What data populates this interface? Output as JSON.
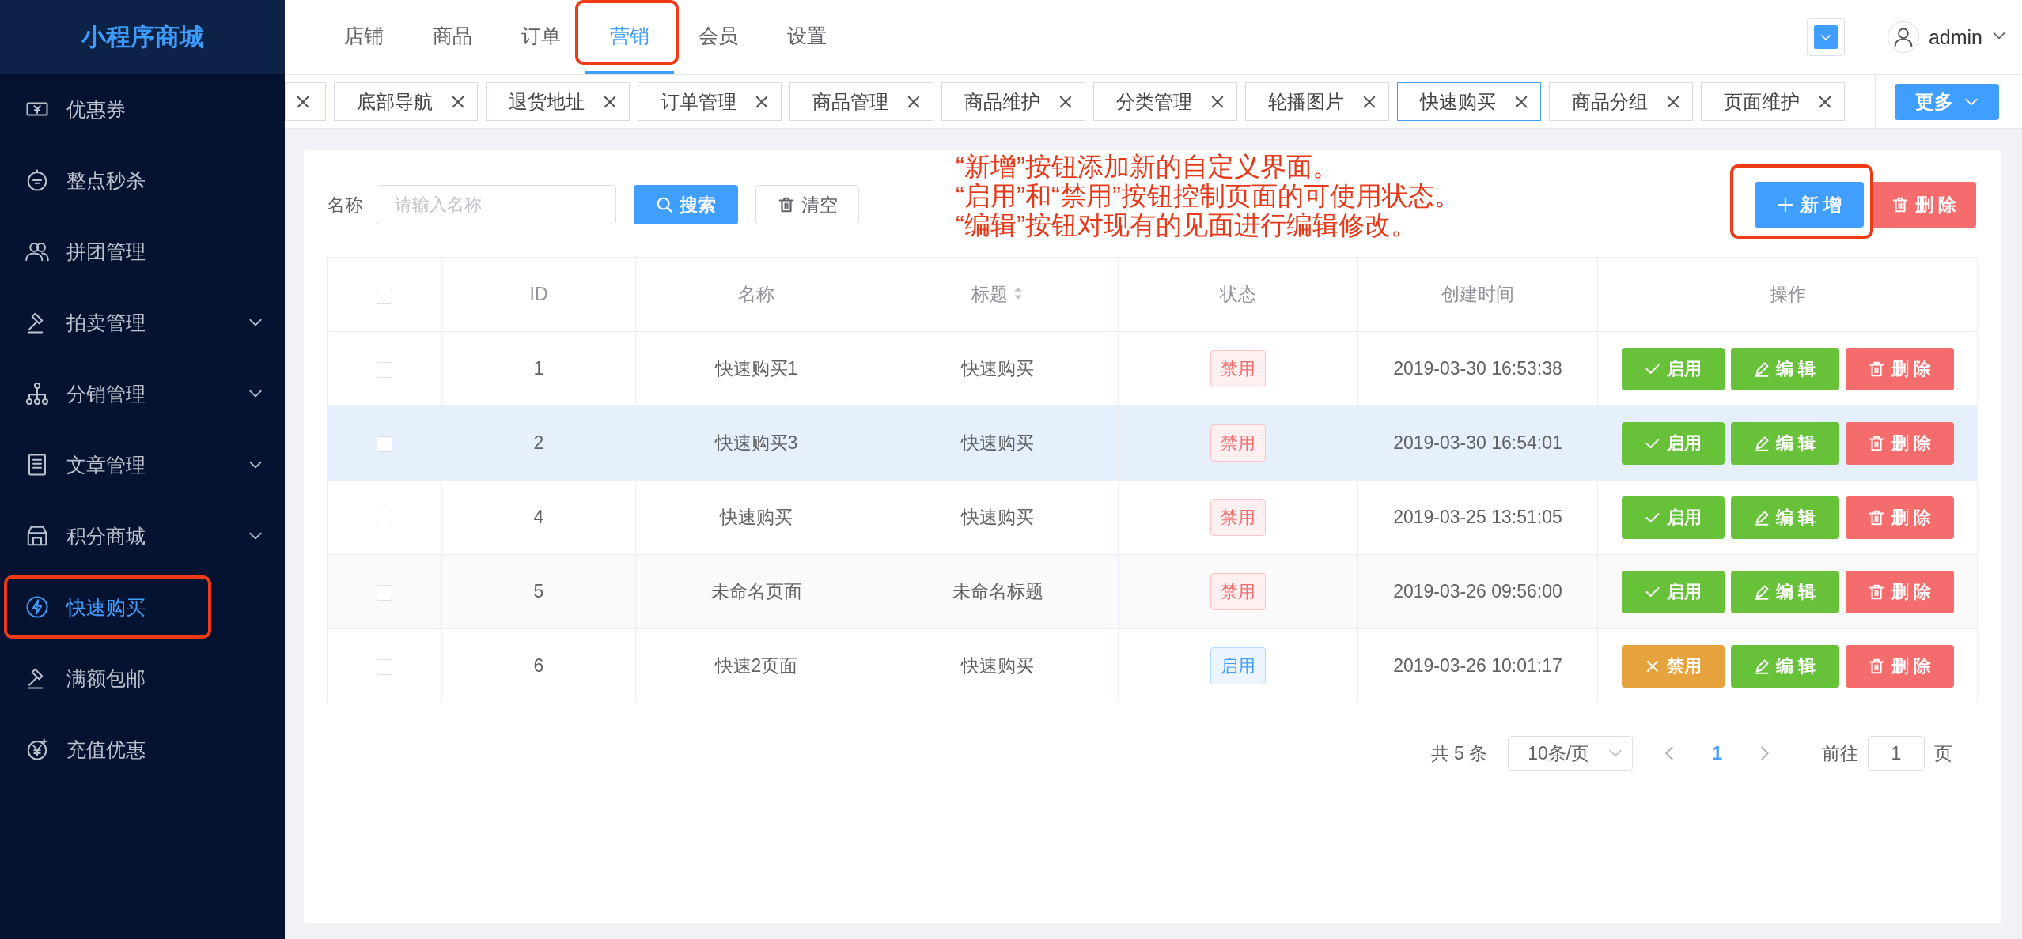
{
  "sidebar": {
    "logo": "小程序商城",
    "items": [
      {
        "label": "优惠券",
        "submenu": false,
        "selected": false,
        "highlighted": false
      },
      {
        "label": "整点秒杀",
        "submenu": false,
        "selected": false,
        "highlighted": false
      },
      {
        "label": "拼团管理",
        "submenu": false,
        "selected": false,
        "highlighted": false
      },
      {
        "label": "拍卖管理",
        "submenu": true,
        "selected": false,
        "highlighted": false
      },
      {
        "label": "分销管理",
        "submenu": true,
        "selected": false,
        "highlighted": false
      },
      {
        "label": "文章管理",
        "submenu": true,
        "selected": false,
        "highlighted": false
      },
      {
        "label": "积分商城",
        "submenu": true,
        "selected": false,
        "highlighted": false
      },
      {
        "label": "快速购买",
        "submenu": false,
        "selected": true,
        "highlighted": true
      },
      {
        "label": "满额包邮",
        "submenu": false,
        "selected": false,
        "highlighted": false
      },
      {
        "label": "充值优惠",
        "submenu": false,
        "selected": false,
        "highlighted": false
      }
    ]
  },
  "top_nav": {
    "items": [
      {
        "label": "店铺",
        "selected": false,
        "highlighted": false
      },
      {
        "label": "商品",
        "selected": false,
        "highlighted": false
      },
      {
        "label": "订单",
        "selected": false,
        "highlighted": false
      },
      {
        "label": "营销",
        "selected": true,
        "highlighted": true
      },
      {
        "label": "会员",
        "selected": false,
        "highlighted": false
      },
      {
        "label": "设置",
        "selected": false,
        "highlighted": false
      }
    ],
    "user": "admin"
  },
  "tags": {
    "items": [
      {
        "selected": false
      },
      {
        "label": "底部导航",
        "selected": false
      },
      {
        "label": "退货地址",
        "selected": false
      },
      {
        "label": "订单管理",
        "selected": false
      },
      {
        "label": "商品管理",
        "selected": false
      },
      {
        "label": "商品维护",
        "selected": false
      },
      {
        "label": "分类管理",
        "selected": false
      },
      {
        "label": "轮播图片",
        "selected": false
      },
      {
        "label": "快速购买",
        "selected": true
      },
      {
        "label": "商品分组",
        "selected": false
      },
      {
        "label": "页面维护",
        "selected": false
      }
    ],
    "more_button": "更多"
  },
  "toolbar": {
    "filter": {
      "label": "名称",
      "placeholder": "请输入名称"
    },
    "search_button": "搜索",
    "clear_button": "清空",
    "add_button": {
      "label": "新 增",
      "highlighted": true
    },
    "delete_button": "删 除"
  },
  "annotation": {
    "lines": [
      "“新增”按钮添加新的自定义界面。",
      "“启用”和“禁用”按钮控制页面的可使用状态。",
      "“编辑”按钮对现有的见面进行编辑修改。"
    ]
  },
  "table": {
    "header_checked": false,
    "columns": [
      {
        "label": "ID",
        "sortable": false
      },
      {
        "label": "名称",
        "sortable": false
      },
      {
        "label": "标题",
        "sortable": true
      },
      {
        "label": "状态",
        "sortable": false
      },
      {
        "label": "创建时间",
        "sortable": false
      },
      {
        "label": "操作",
        "sortable": false
      }
    ],
    "rows": [
      {
        "checked": false,
        "hovered": false,
        "id": "1",
        "name": "快速购买1",
        "title": "快速购买",
        "status": {
          "label": "禁用",
          "kind": "disabled"
        },
        "created": "2019-03-30 16:53:38",
        "actions": [
          {
            "label": "启用",
            "kind": "enable"
          },
          {
            "label": "编 辑",
            "kind": "edit"
          },
          {
            "label": "删 除",
            "kind": "delete"
          }
        ]
      },
      {
        "checked": false,
        "hovered": true,
        "id": "2",
        "name": "快速购买3",
        "title": "快速购买",
        "status": {
          "label": "禁用",
          "kind": "disabled"
        },
        "created": "2019-03-30 16:54:01",
        "actions": [
          {
            "label": "启用",
            "kind": "enable"
          },
          {
            "label": "编 辑",
            "kind": "edit"
          },
          {
            "label": "删 除",
            "kind": "delete"
          }
        ]
      },
      {
        "checked": false,
        "hovered": false,
        "id": "4",
        "name": "快速购买",
        "title": "快速购买",
        "status": {
          "label": "禁用",
          "kind": "disabled"
        },
        "created": "2019-03-25 13:51:05",
        "actions": [
          {
            "label": "启用",
            "kind": "enable"
          },
          {
            "label": "编 辑",
            "kind": "edit"
          },
          {
            "label": "删 除",
            "kind": "delete"
          }
        ]
      },
      {
        "checked": false,
        "hovered": false,
        "id": "5",
        "name": "未命名页面",
        "title": "未命名标题",
        "status": {
          "label": "禁用",
          "kind": "disabled"
        },
        "created": "2019-03-26 09:56:00",
        "actions": [
          {
            "label": "启用",
            "kind": "enable"
          },
          {
            "label": "编 辑",
            "kind": "edit"
          },
          {
            "label": "删 除",
            "kind": "delete"
          }
        ]
      },
      {
        "checked": false,
        "hovered": false,
        "id": "6",
        "name": "快速2页面",
        "title": "快速购买",
        "status": {
          "label": "启用",
          "kind": "enabled"
        },
        "created": "2019-03-26 10:01:17",
        "actions": [
          {
            "label": "禁用",
            "kind": "disable"
          },
          {
            "label": "编 辑",
            "kind": "edit"
          },
          {
            "label": "删 除",
            "kind": "delete"
          }
        ]
      }
    ]
  },
  "pagination": {
    "total": "共 5 条",
    "page_size": "10条/页",
    "pages": [
      {
        "label": "1",
        "selected": true
      }
    ],
    "goto_label": "前往",
    "goto_value": "1",
    "goto_suffix": "页"
  }
}
